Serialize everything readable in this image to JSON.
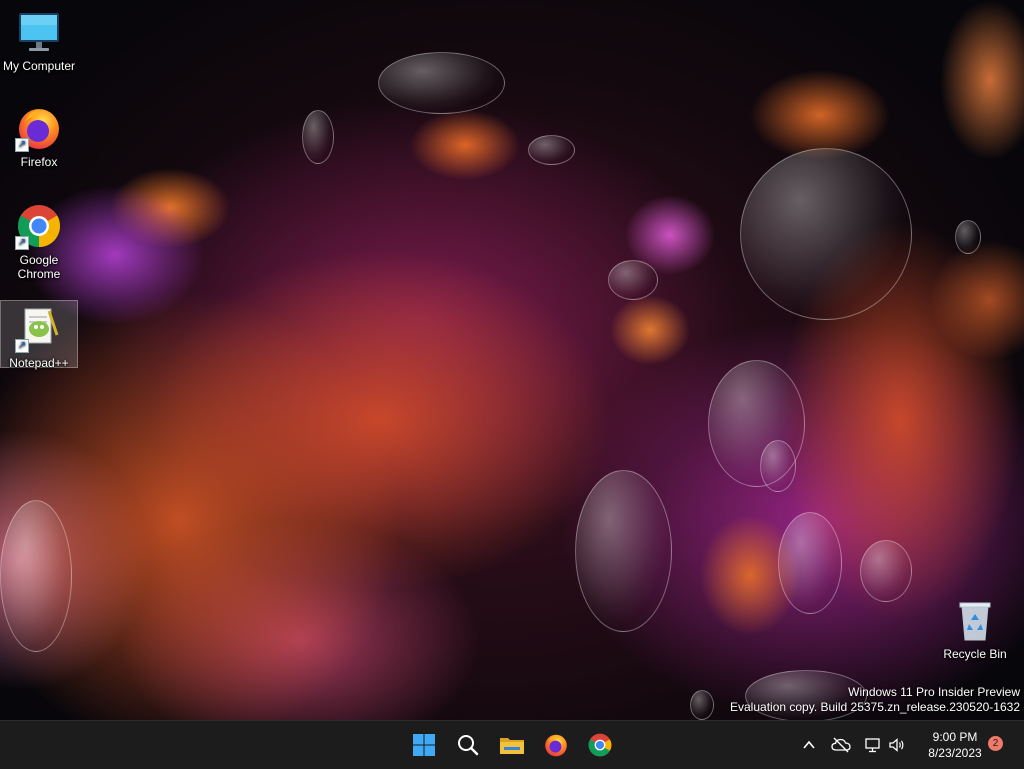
{
  "desktop": {
    "icons": [
      {
        "label": "My Computer"
      },
      {
        "label": "Firefox"
      },
      {
        "label": "Google Chrome"
      },
      {
        "label": "Notepad++"
      },
      {
        "label": "Recycle Bin"
      }
    ],
    "watermark": {
      "line1": "Windows 11 Pro Insider Preview",
      "line2": "Evaluation copy. Build 25375.zn_release.230520-1632"
    }
  },
  "taskbar": {
    "pinned": [
      {
        "icon": "windows-start-icon"
      },
      {
        "icon": "search-icon"
      },
      {
        "icon": "file-explorer-icon"
      },
      {
        "icon": "firefox-icon"
      },
      {
        "icon": "chrome-icon"
      }
    ],
    "tray": {
      "chevron_icon": "chevron-up-icon",
      "cloud_icon": "cloud-offline-icon",
      "network_icon": "network-icon",
      "volume_icon": "volume-icon"
    },
    "clock": {
      "time": "9:00 PM",
      "date": "8/23/2023"
    },
    "notification_count": "2"
  },
  "colors": {
    "taskbar_bg": "#1c1c1c",
    "start_blue": "#3fa9f5",
    "folder_yellow": "#f3c13a",
    "badge": "#f07a6a"
  }
}
